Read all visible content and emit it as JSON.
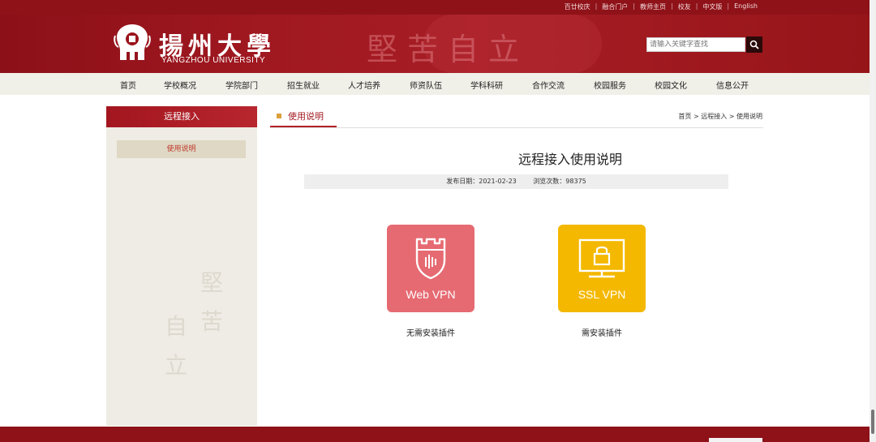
{
  "top_links": [
    "百廿校庆",
    "融合门户",
    "教师主页",
    "校友",
    "中文版",
    "English"
  ],
  "header": {
    "university_cn": "揚州大學",
    "university_en": "YANGZHOU UNIVERSITY",
    "motto": "堅苦自立",
    "search_placeholder": "请输入关键字查找"
  },
  "nav": [
    "首页",
    "学校概况",
    "学院部门",
    "招生就业",
    "人才培养",
    "师资队伍",
    "学科科研",
    "合作交流",
    "校园服务",
    "校园文化",
    "信息公开"
  ],
  "sidebar": {
    "title": "远程接入",
    "items": [
      {
        "label": "使用说明"
      }
    ]
  },
  "main": {
    "tab_title": "使用说明",
    "breadcrumb": [
      "首页",
      "远程接入",
      "使用说明"
    ],
    "breadcrumb_separator": ">",
    "article_title": "远程接入使用说明",
    "meta": {
      "publish_label": "发布日期：",
      "publish_date": "2021-02-23",
      "views_label": "浏览次数：",
      "views": "98375"
    },
    "cards": [
      {
        "label": "Web VPN",
        "caption": "无需安装插件",
        "color": "#e66a72",
        "icon": "castle-shield-icon"
      },
      {
        "label": "SSL VPN",
        "caption": "需安装插件",
        "color": "#f4b800",
        "icon": "monitor-lock-icon"
      }
    ]
  },
  "colors": {
    "brand_red": "#8f1219",
    "accent_red": "#b22029",
    "sidebar_bg": "#eeece4"
  }
}
